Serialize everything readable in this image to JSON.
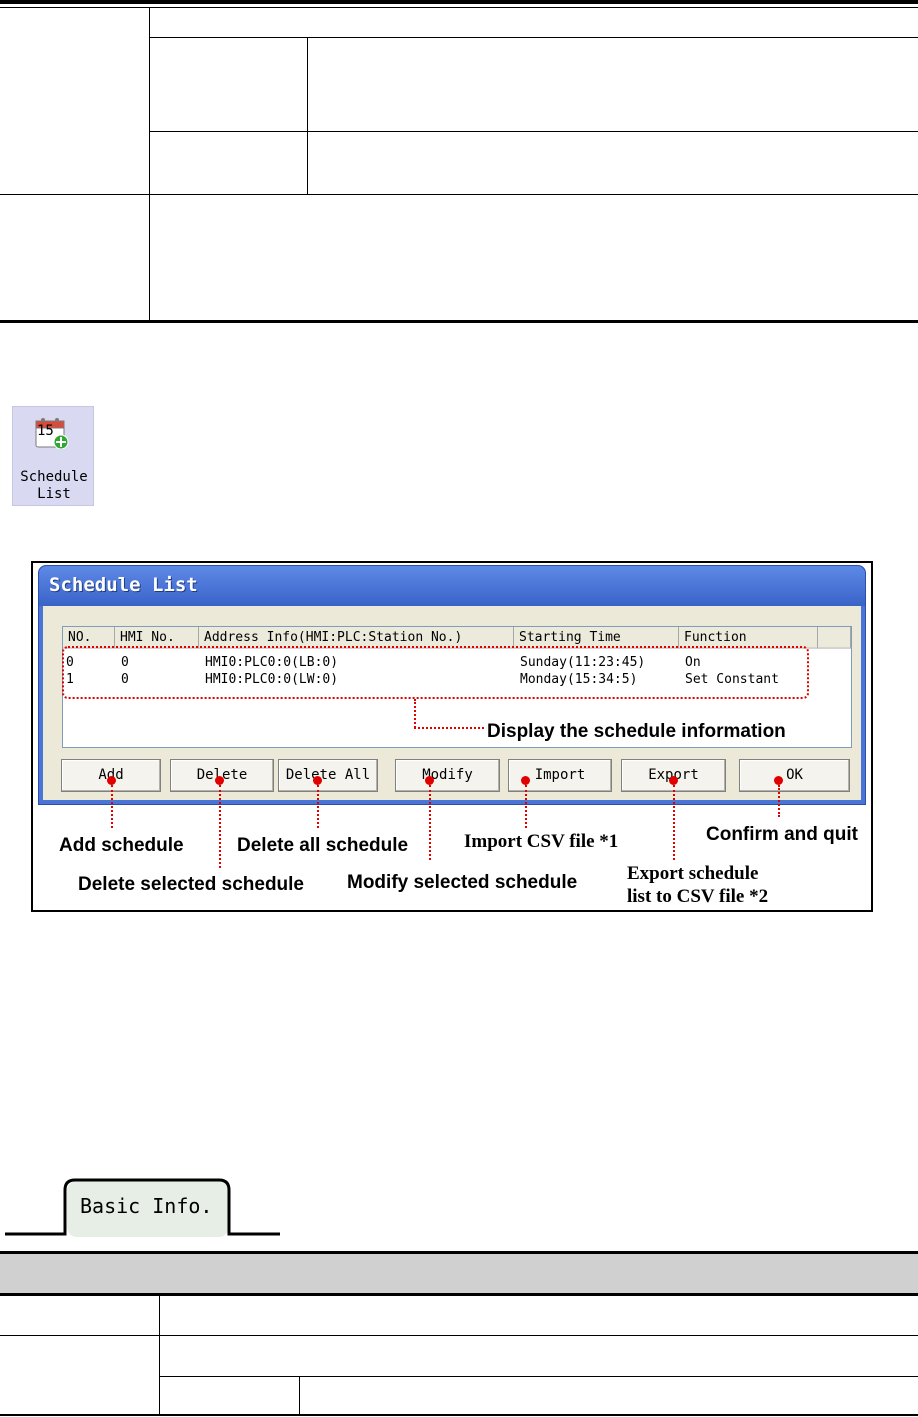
{
  "icon": {
    "label_line1": "Schedule",
    "label_line2": "List",
    "glyph": "calendar-15-add-icon",
    "calendar_number": "15"
  },
  "dialog": {
    "title": "Schedule List",
    "columns": [
      "NO.",
      "HMI No.",
      "Address Info(HMI:PLC:Station No.)",
      "Starting Time",
      "Function",
      ""
    ],
    "rows": [
      {
        "no": "0",
        "hmi": "0",
        "address": "HMI0:PLC0:0(LB:0)",
        "time": "Sunday(11:23:45)",
        "function": "On"
      },
      {
        "no": "1",
        "hmi": "0",
        "address": "HMI0:PLC0:0(LW:0)",
        "time": "Monday(15:34:5)",
        "function": "Set Constant"
      }
    ],
    "buttons": {
      "add": "Add",
      "delete": "Delete",
      "delete_all": "Delete All",
      "modify": "Modify",
      "import": "Import",
      "export": "Export",
      "ok": "OK"
    }
  },
  "annotations": {
    "display": "Display the schedule information",
    "add": "Add schedule",
    "delete": "Delete selected schedule",
    "delete_all": "Delete all schedule",
    "modify": "Modify selected schedule",
    "import": "Import CSV file *1",
    "export_line1": "Export schedule",
    "export_line2": "list to CSV file *2",
    "ok": "Confirm and quit"
  },
  "tab": {
    "label": "Basic Info."
  },
  "colors": {
    "title_bar": "#3a63c8",
    "annotation": "#e00000",
    "section_header": "#d0d0d0"
  }
}
